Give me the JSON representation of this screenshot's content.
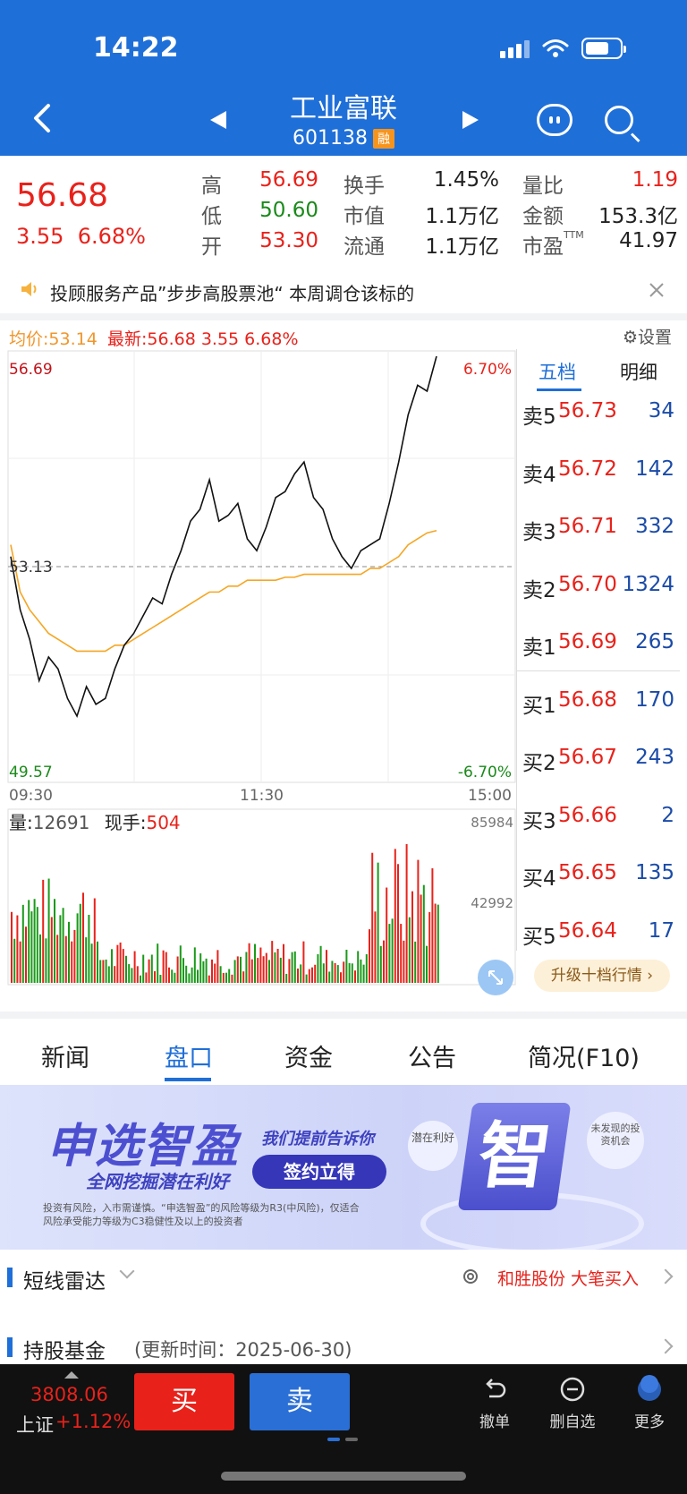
{
  "status": {
    "time": "14:22"
  },
  "header": {
    "name": "工业富联",
    "code": "601138",
    "badge": "融"
  },
  "quote": {
    "price": "56.68",
    "change": "3.55",
    "change_pct": "6.68%",
    "cells": [
      {
        "label": "高",
        "value": "56.69",
        "color": "#e8221b"
      },
      {
        "label": "低",
        "value": "50.60",
        "color": "#1a8a1a"
      },
      {
        "label": "开",
        "value": "53.30",
        "color": "#e8221b"
      },
      {
        "label": "换手",
        "value": "1.45%",
        "color": "#222"
      },
      {
        "label": "市值",
        "value": "1.1万亿",
        "color": "#222"
      },
      {
        "label": "流通",
        "value": "1.1万亿",
        "color": "#222"
      },
      {
        "label": "量比",
        "value": "1.19",
        "color": "#e8221b"
      },
      {
        "label": "金额",
        "value": "153.3亿",
        "color": "#222"
      },
      {
        "label": "市盈",
        "value": "41.97",
        "color": "#222",
        "sup": "TTM"
      }
    ]
  },
  "notice": {
    "text": "投顾服务产品”步步高股票池“ 本周调仓该标的"
  },
  "chart": {
    "avg_label": "均价:53.14",
    "latest_label": "最新:56.68 3.55 6.68%",
    "settings_label": "设置",
    "y_high": "56.69",
    "y_low": "49.57",
    "y_mid": "53.13",
    "pct_high": "6.70%",
    "pct_low": "-6.70%",
    "times": [
      "09:30",
      "11:30",
      "15:00"
    ],
    "vol_label_prefix": "量:",
    "vol_value": "12691",
    "hand_label": "现手:",
    "hand_value": "504",
    "vol_high": "85984",
    "vol_mid": "42992"
  },
  "chart_data": {
    "type": "line",
    "title": "",
    "ylim": [
      49.57,
      56.69
    ],
    "price_series": [
      53.3,
      52.4,
      51.9,
      51.2,
      51.6,
      51.4,
      50.9,
      50.6,
      51.1,
      50.8,
      50.9,
      51.4,
      51.8,
      52.0,
      52.3,
      52.6,
      52.5,
      53.0,
      53.4,
      53.9,
      54.1,
      54.6,
      53.9,
      54.0,
      54.2,
      53.6,
      53.4,
      53.8,
      54.3,
      54.4,
      54.7,
      54.9,
      54.3,
      54.1,
      53.6,
      53.3,
      53.1,
      53.4,
      53.5,
      53.6,
      54.2,
      54.9,
      55.7,
      56.2,
      56.1,
      56.69
    ],
    "avg_series": [
      53.5,
      52.7,
      52.4,
      52.2,
      52.0,
      51.9,
      51.8,
      51.7,
      51.7,
      51.7,
      51.7,
      51.8,
      51.8,
      51.9,
      52.0,
      52.1,
      52.2,
      52.3,
      52.4,
      52.5,
      52.6,
      52.7,
      52.7,
      52.8,
      52.8,
      52.9,
      52.9,
      52.9,
      52.9,
      52.95,
      52.95,
      53.0,
      53.0,
      53.0,
      53.0,
      53.0,
      53.0,
      53.0,
      53.1,
      53.1,
      53.2,
      53.3,
      53.5,
      53.6,
      53.7,
      53.74
    ],
    "prev_close": 53.13,
    "volume_ylim": [
      0,
      85984
    ]
  },
  "order_book": {
    "tabs": [
      "五档",
      "明细"
    ],
    "asks": [
      {
        "label": "卖5",
        "price": "56.73",
        "vol": "34"
      },
      {
        "label": "卖4",
        "price": "56.72",
        "vol": "142"
      },
      {
        "label": "卖3",
        "price": "56.71",
        "vol": "332"
      },
      {
        "label": "卖2",
        "price": "56.70",
        "vol": "1324"
      },
      {
        "label": "卖1",
        "price": "56.69",
        "vol": "265"
      }
    ],
    "bids": [
      {
        "label": "买1",
        "price": "56.68",
        "vol": "170"
      },
      {
        "label": "买2",
        "price": "56.67",
        "vol": "243"
      },
      {
        "label": "买3",
        "price": "56.66",
        "vol": "2"
      },
      {
        "label": "买4",
        "price": "56.65",
        "vol": "135"
      },
      {
        "label": "买5",
        "price": "56.64",
        "vol": "17"
      }
    ],
    "upgrade": "升级十档行情 ›"
  },
  "tabs": [
    "新闻",
    "盘口",
    "资金",
    "公告",
    "简况(F10)"
  ],
  "banner": {
    "title": "申选智盈",
    "sub": "全网挖掘潜在利好",
    "hint": "我们提前告诉你",
    "button": "签约立得",
    "disclaimer": "投资有风险，入市需谨慎。“申选智盈”的风险等级为R3(中风险)，仅适合风险承受能力等级为C3稳健性及以上的投资者",
    "bubble1": "潜在利好",
    "bubble2": "未发现的投资机会",
    "big": "智"
  },
  "radar": {
    "title": "短线雷达",
    "text": "和胜股份 大笔买入"
  },
  "fund": {
    "title": "持股基金",
    "sub": "(更新时间：2025-06-30)"
  },
  "bottom": {
    "index_value": "3808.06",
    "index_name": "上证",
    "index_chg": "+1.12%",
    "buy": "买",
    "sell": "卖",
    "tools": [
      "撤单",
      "删自选",
      "更多"
    ]
  }
}
